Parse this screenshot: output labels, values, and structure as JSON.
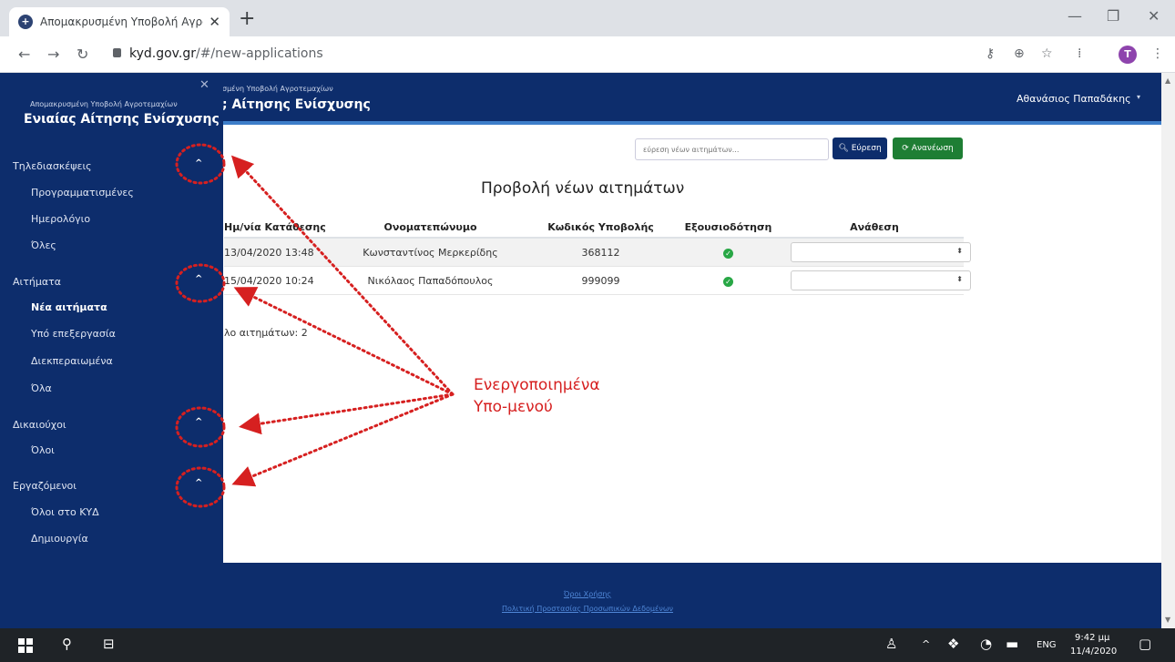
{
  "browser": {
    "tab_title": "Απομακρυσμένη Υποβολή Αγρο",
    "url_host": "kyd.gov.gr",
    "url_path": "/#/new-applications",
    "profile_initial": "T"
  },
  "header": {
    "subtitle_partial": "σμένη Υποβολή Αγροτεμαχίων",
    "title_partial": "; Αίτησης Ενίσχυσης",
    "user_name": "Αθανάσιος Παπαδάκης"
  },
  "toolbar": {
    "search_placeholder": "εύρεση νέων αιτημάτων...",
    "search_label": "Εύρεση",
    "refresh_label": "Ανανέωση"
  },
  "page_title": "Προβολή νέων αιτημάτων",
  "table": {
    "columns": [
      "Ημ/νία Κατάθεσης",
      "Ονοματεπώνυμο",
      "Κωδικός Υποβολής",
      "Εξουσιοδότηση",
      "Ανάθεση"
    ],
    "rows": [
      {
        "date": "13/04/2020 13:48",
        "name": "Κωνσταντίνος Μερκερίδης",
        "code": "368112",
        "authorized": true
      },
      {
        "date": "15/04/2020 10:24",
        "name": "Νικόλαος Παπαδόπουλος",
        "code": "999099",
        "authorized": true
      }
    ]
  },
  "total_label": "λο αιτημάτων: 2",
  "footer": {
    "terms": "Όροι Χρήσης",
    "privacy": "Πολιτική Προστασίας Προσωπικών Δεδομένων"
  },
  "sidebar": {
    "subtitle": "Απομακρυσμένη Υποβολή Αγροτεμαχίων",
    "title": "Ενιαίας Αίτησης Ενίσχυσης",
    "groups": [
      {
        "label": "Τηλεδιασκέψεις",
        "items": [
          "Προγραμματισμένες",
          "Ημερολόγιο",
          "Όλες"
        ]
      },
      {
        "label": "Αιτήματα",
        "items": [
          "Νέα αιτήματα",
          "Υπό επεξεργασία",
          "Διεκπεραιωμένα",
          "Όλα"
        ]
      },
      {
        "label": "Δικαιούχοι",
        "items": [
          "Όλοι"
        ]
      },
      {
        "label": "Εργαζόμενοι",
        "items": [
          "Όλοι στο ΚΥΔ",
          "Δημιουργία"
        ]
      }
    ],
    "active_item": "Νέα αιτήματα"
  },
  "annotation": {
    "line1": "Ενεργοποιημένα",
    "line2": "Υπο-μενού",
    "color": "#d62020"
  },
  "taskbar": {
    "language": "ENG",
    "time": "9:42 μμ",
    "date": "11/4/2020"
  },
  "colors": {
    "brand_navy": "#0d2d6c",
    "accent_blue": "#3d7ec9",
    "success_green": "#1e7e34"
  }
}
